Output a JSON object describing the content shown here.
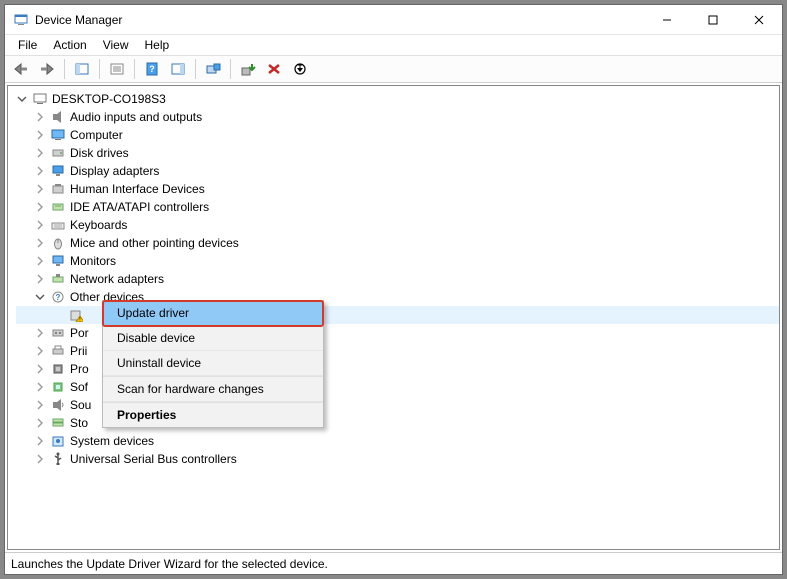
{
  "window": {
    "title": "Device Manager"
  },
  "menubar": [
    "File",
    "Action",
    "View",
    "Help"
  ],
  "root": {
    "label": "DESKTOP-CO198S3"
  },
  "categories": [
    {
      "label": "Audio inputs and outputs",
      "icon": "audio"
    },
    {
      "label": "Computer",
      "icon": "computer"
    },
    {
      "label": "Disk drives",
      "icon": "disk"
    },
    {
      "label": "Display adapters",
      "icon": "display"
    },
    {
      "label": "Human Interface Devices",
      "icon": "hid"
    },
    {
      "label": "IDE ATA/ATAPI controllers",
      "icon": "ide"
    },
    {
      "label": "Keyboards",
      "icon": "keyboard"
    },
    {
      "label": "Mice and other pointing devices",
      "icon": "mouse"
    },
    {
      "label": "Monitors",
      "icon": "monitor"
    },
    {
      "label": "Network adapters",
      "icon": "network"
    },
    {
      "label": "Other devices",
      "icon": "other",
      "expanded": true
    },
    {
      "label": "Por",
      "icon": "port",
      "partial": true
    },
    {
      "label": "Prii",
      "icon": "printer",
      "partial": true
    },
    {
      "label": "Pro",
      "icon": "processor",
      "partial": true
    },
    {
      "label": "Sof",
      "icon": "software",
      "partial": true
    },
    {
      "label": "Sou",
      "icon": "sound",
      "partial": true
    },
    {
      "label": "Sto",
      "icon": "storage",
      "partial": true
    },
    {
      "label": "System devices",
      "icon": "system"
    },
    {
      "label": "Universal Serial Bus controllers",
      "icon": "usb"
    }
  ],
  "other_child_icon": "unknown-warning",
  "context_menu": {
    "items": [
      {
        "label": "Update driver",
        "highlight": true
      },
      {
        "label": "Disable device"
      },
      {
        "label": "Uninstall device"
      },
      {
        "label": "Scan for hardware changes",
        "gap_before": true
      },
      {
        "label": "Properties",
        "bold": true,
        "gap_before": true
      }
    ]
  },
  "statusbar": "Launches the Update Driver Wizard for the selected device."
}
